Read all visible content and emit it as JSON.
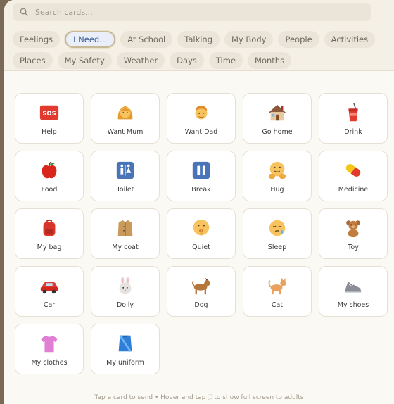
{
  "search": {
    "placeholder": "Search cards..."
  },
  "categories": [
    {
      "label": "Feelings",
      "active": false
    },
    {
      "label": "I Need...",
      "active": true
    },
    {
      "label": "At School",
      "active": false
    },
    {
      "label": "Talking",
      "active": false
    },
    {
      "label": "My Body",
      "active": false
    },
    {
      "label": "People",
      "active": false
    },
    {
      "label": "Activities",
      "active": false
    },
    {
      "label": "Places",
      "active": false
    },
    {
      "label": "My Safety",
      "active": false
    },
    {
      "label": "Weather",
      "active": false
    },
    {
      "label": "Days",
      "active": false
    },
    {
      "label": "Time",
      "active": false
    },
    {
      "label": "Months",
      "active": false
    }
  ],
  "cards": [
    {
      "label": "Help",
      "icon": "sos-icon"
    },
    {
      "label": "Want Mum",
      "icon": "woman-icon"
    },
    {
      "label": "Want Dad",
      "icon": "man-icon"
    },
    {
      "label": "Go home",
      "icon": "house-icon"
    },
    {
      "label": "Drink",
      "icon": "cup-with-straw-icon"
    },
    {
      "label": "Food",
      "icon": "apple-icon"
    },
    {
      "label": "Toilet",
      "icon": "restroom-icon"
    },
    {
      "label": "Break",
      "icon": "pause-icon"
    },
    {
      "label": "Hug",
      "icon": "hugging-face-icon"
    },
    {
      "label": "Medicine",
      "icon": "pill-icon"
    },
    {
      "label": "My bag",
      "icon": "backpack-icon"
    },
    {
      "label": "My coat",
      "icon": "coat-icon"
    },
    {
      "label": "Quiet",
      "icon": "shushing-face-icon"
    },
    {
      "label": "Sleep",
      "icon": "sleepy-face-icon"
    },
    {
      "label": "Toy",
      "icon": "teddy-bear-icon"
    },
    {
      "label": "Car",
      "icon": "car-icon"
    },
    {
      "label": "Dolly",
      "icon": "rabbit-icon"
    },
    {
      "label": "Dog",
      "icon": "dog-icon"
    },
    {
      "label": "Cat",
      "icon": "cat-icon"
    },
    {
      "label": "My shoes",
      "icon": "sneaker-icon"
    },
    {
      "label": "My clothes",
      "icon": "t-shirt-icon"
    },
    {
      "label": "My uniform",
      "icon": "uniform-icon"
    }
  ],
  "footer": {
    "hint": "Tap a card to send • Hover and tap ⛶ to show full screen to adults"
  }
}
